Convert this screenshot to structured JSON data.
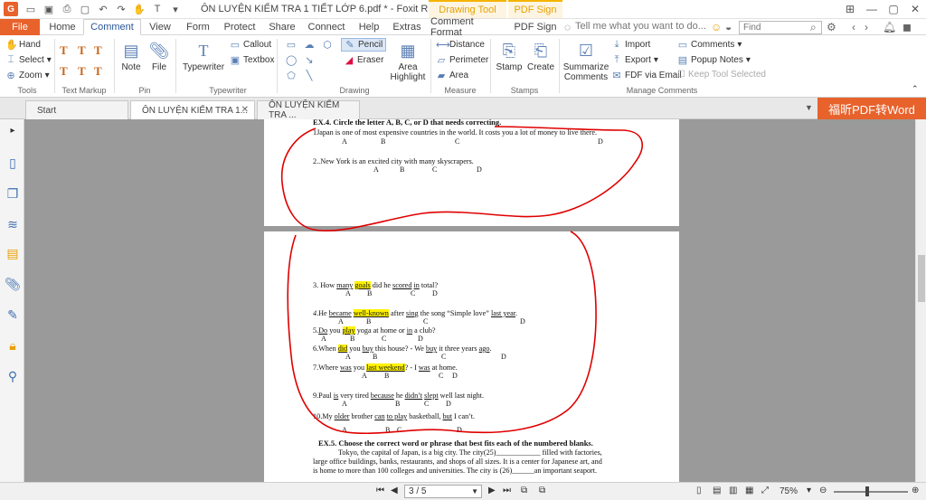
{
  "titlebar": {
    "logo": "G",
    "title": "ÔN LUYỆN KIỂM TRA 1 TIẾT LỚP 6.pdf * - Foxit Reader",
    "context_tabs": [
      "Drawing Tool",
      "PDF Sign"
    ]
  },
  "tabs": [
    "File",
    "Home",
    "Comment",
    "View",
    "Form",
    "Protect",
    "Share",
    "Connect",
    "Help",
    "Extras",
    "Comment Format",
    "PDF Sign"
  ],
  "tell_me": "Tell me what you want to do...",
  "find_placeholder": "Find",
  "ribbon": {
    "tools": {
      "label": "Tools",
      "hand": "Hand",
      "select": "Select",
      "zoom": "Zoom"
    },
    "text_markup": {
      "label": "Text Markup"
    },
    "pin": {
      "label": "Pin",
      "note": "Note",
      "file": "File"
    },
    "typewriter": {
      "label": "Typewriter",
      "typewriter": "Typewriter",
      "callout": "Callout",
      "textbox": "Textbox"
    },
    "drawing": {
      "label": "Drawing",
      "pencil": "Pencil",
      "eraser": "Eraser",
      "area_highlight": "Area Highlight"
    },
    "measure": {
      "label": "Measure",
      "distance": "Distance",
      "perimeter": "Perimeter",
      "area": "Area"
    },
    "stamps": {
      "label": "Stamps",
      "stamp": "Stamp",
      "create": "Create"
    },
    "manage": {
      "label": "Manage Comments",
      "summarize": "Summarize Comments",
      "import": "Import",
      "export": "Export",
      "fdf_email": "FDF via Email",
      "comments": "Comments",
      "popup_notes": "Popup Notes",
      "keep_tool": "Keep Tool Selected"
    }
  },
  "doc_tabs": [
    "Start",
    "ÔN LUYỆN KIỂM TRA 1...",
    "ÔN LUYỆN KIỂM TRA ..."
  ],
  "promo": "福昕PDF转Word",
  "page1": {
    "header": "EX.4. Circle the letter A, B, C, or D that needs correcting.",
    "q1": "1Japan is one of most expensive countries in the world. It costs you a lot of money to live there.",
    "q2": "2..New York is an excited city with many skyscrapers."
  },
  "page2": {
    "q3": "3. How many goals did he scored in total?",
    "q4": "4.He became well-known after sing the song “Simple love” last year.",
    "q5": "5.Do you play yoga at home or in a club?",
    "q6": "6.When did you buy this house? - We buy it three years ago.",
    "q7": "7.Where was you last weekend? - I was at home.",
    "q9": "9.Paul is very tired because he didn’t slept well last night.",
    "q10": "10.My older brother can to play basketball, but I can’t.",
    "ex5": "EX.5. Choose the correct word or phrase that best fits each of the numbered blanks.",
    "p1": "Tokyo, the capital of Japan, is a big city. The city(25)____________ filled with factories,",
    "p2": "large office buildings, banks, restaurants, and shops of all sizes. It is a center for Japanese art, and",
    "p3": "is home to more than 100 colleges and universities. The city is (26)______an important seaport."
  },
  "letters": {
    "A": "A",
    "B": "B",
    "C": "C",
    "D": "D"
  },
  "status": {
    "page": "3 / 5",
    "zoom": "75%"
  },
  "colors": {
    "accent": "#e8622c",
    "annotation": "#e00000",
    "highlight": "#fff200"
  }
}
